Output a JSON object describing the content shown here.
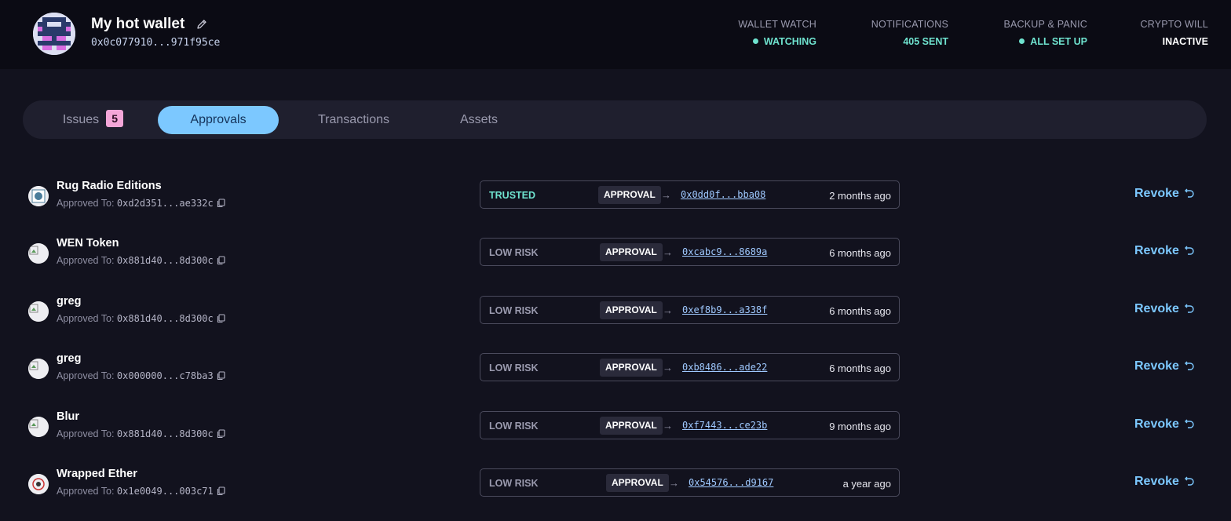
{
  "header": {
    "wallet_name": "My hot wallet",
    "wallet_address": "0x0c077910...971f95ce",
    "stats": [
      {
        "label": "WALLET WATCH",
        "value": "WATCHING",
        "status": "dot"
      },
      {
        "label": "NOTIFICATIONS",
        "value": "405 SENT",
        "status": "none"
      },
      {
        "label": "BACKUP & PANIC",
        "value": "ALL SET UP",
        "status": "dot"
      },
      {
        "label": "CRYPTO WILL",
        "value": "INACTIVE",
        "status": "none"
      }
    ]
  },
  "tabs": [
    {
      "label": "Issues",
      "badge": "5"
    },
    {
      "label": "Approvals"
    },
    {
      "label": "Transactions"
    },
    {
      "label": "Assets"
    }
  ],
  "active_tab": "Approvals",
  "approved_to_label": "Approved To:",
  "approval_tag": "APPROVAL",
  "revoke_label": "Revoke",
  "colors": {
    "accent": "#7cc8ff",
    "trusted": "#6fe3cf",
    "badge": "#f4a6d8"
  },
  "approvals": [
    {
      "token": "Rug Radio Editions",
      "approved_to": "0xd2d351...ae332c",
      "risk": "TRUSTED",
      "spender": "0x0dd0f...bba08",
      "time": "2 months ago"
    },
    {
      "token": "WEN Token",
      "approved_to": "0x881d40...8d300c",
      "risk": "LOW RISK",
      "spender": "0xcabc9...8689a",
      "time": "6 months ago"
    },
    {
      "token": "greg",
      "approved_to": "0x881d40...8d300c",
      "risk": "LOW RISK",
      "spender": "0xef8b9...a338f",
      "time": "6 months ago"
    },
    {
      "token": "greg",
      "approved_to": "0x000000...c78ba3",
      "risk": "LOW RISK",
      "spender": "0xb8486...ade22",
      "time": "6 months ago"
    },
    {
      "token": "Blur",
      "approved_to": "0x881d40...8d300c",
      "risk": "LOW RISK",
      "spender": "0xf7443...ce23b",
      "time": "9 months ago"
    },
    {
      "token": "Wrapped Ether",
      "approved_to": "0x1e0049...003c71",
      "risk": "LOW RISK",
      "spender": "0x54576...d9167",
      "time": "a year ago"
    }
  ]
}
